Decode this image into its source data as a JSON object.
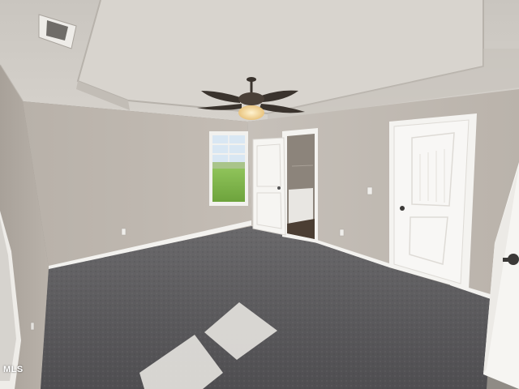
{
  "photo": {
    "watermark": "MLS",
    "colors": {
      "wall": "#bdb6ae",
      "ceiling": "#cfcbc5",
      "carpet": "#5d5c5e",
      "trim": "#f4f3f0",
      "fan": "#3a332d",
      "light": "#f3d9a3",
      "grass": "#7fb34a"
    }
  }
}
